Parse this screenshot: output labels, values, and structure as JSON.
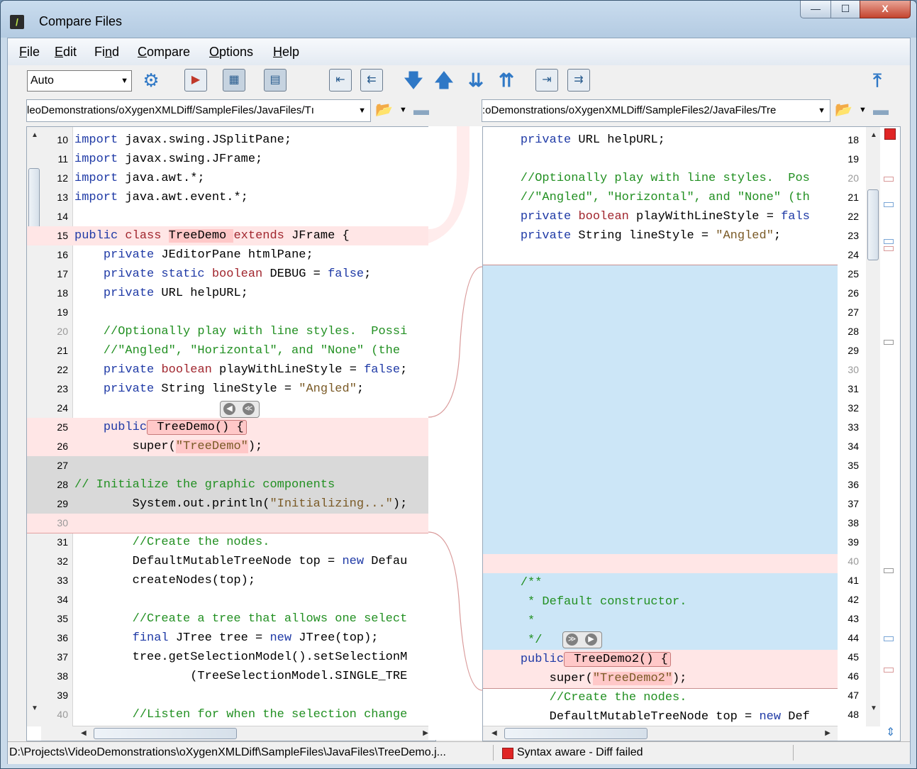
{
  "window": {
    "title": "Compare Files",
    "min_glyph": "—",
    "max_glyph": "☐",
    "close_glyph": "X"
  },
  "menu": [
    {
      "pre": "",
      "u": "F",
      "post": "ile"
    },
    {
      "pre": "",
      "u": "E",
      "post": "dit"
    },
    {
      "pre": "Fi",
      "u": "n",
      "post": "d"
    },
    {
      "pre": "",
      "u": "C",
      "post": "ompare"
    },
    {
      "pre": "",
      "u": "O",
      "post": "ptions"
    },
    {
      "pre": "",
      "u": "H",
      "post": "elp"
    }
  ],
  "toolbar": {
    "mode": "Auto"
  },
  "left": {
    "path": "leoDemonstrations/oXygenXMLDiff/SampleFiles/JavaFiles/Tı",
    "lines": [
      {
        "n": "10",
        "t": "import javax.swing.JSplitPane;"
      },
      {
        "n": "11",
        "t": "import javax.swing.JFrame;"
      },
      {
        "n": "12",
        "t": "import java.awt.*;"
      },
      {
        "n": "13",
        "t": "import java.awt.event.*;"
      },
      {
        "n": "14",
        "t": ""
      },
      {
        "n": "15",
        "t": "public class TreeDemo extends JFrame {"
      },
      {
        "n": "16",
        "t": "    private JEditorPane htmlPane;"
      },
      {
        "n": "17",
        "t": "    private static boolean DEBUG = false;"
      },
      {
        "n": "18",
        "t": "    private URL helpURL;"
      },
      {
        "n": "19",
        "t": ""
      },
      {
        "n": "20",
        "t": "    //Optionally play with line styles.  Possi"
      },
      {
        "n": "21",
        "t": "    //\"Angled\", \"Horizontal\", and \"None\" (the"
      },
      {
        "n": "22",
        "t": "    private boolean playWithLineStyle = false;"
      },
      {
        "n": "23",
        "t": "    private String lineStyle = \"Angled\";"
      },
      {
        "n": "24",
        "t": ""
      },
      {
        "n": "25",
        "t": "    public TreeDemo() {"
      },
      {
        "n": "26",
        "t": "        super(\"TreeDemo\");"
      },
      {
        "n": "27",
        "t": ""
      },
      {
        "n": "28",
        "t": "// Initialize the graphic components"
      },
      {
        "n": "29",
        "t": "        System.out.println(\"Initializing...\");"
      },
      {
        "n": "30",
        "t": ""
      },
      {
        "n": "31",
        "t": "        //Create the nodes."
      },
      {
        "n": "32",
        "t": "        DefaultMutableTreeNode top = new Defau"
      },
      {
        "n": "33",
        "t": "        createNodes(top);"
      },
      {
        "n": "34",
        "t": ""
      },
      {
        "n": "35",
        "t": "        //Create a tree that allows one select"
      },
      {
        "n": "36",
        "t": "        final JTree tree = new JTree(top);"
      },
      {
        "n": "37",
        "t": "        tree.getSelectionModel().setSelectionM"
      },
      {
        "n": "38",
        "t": "                (TreeSelectionModel.SINGLE_TRE"
      },
      {
        "n": "39",
        "t": ""
      },
      {
        "n": "40",
        "t": "        //Listen for when the selection change"
      }
    ]
  },
  "right": {
    "path": ":oDemonstrations/oXygenXMLDiff/SampleFiles2/JavaFiles/Tre",
    "lines": [
      {
        "n": "18",
        "t": "    private URL helpURL;"
      },
      {
        "n": "19",
        "t": ""
      },
      {
        "n": "20",
        "t": "    //Optionally play with line styles.  Pos"
      },
      {
        "n": "21",
        "t": "    //\"Angled\", \"Horizontal\", and \"None\" (th"
      },
      {
        "n": "22",
        "t": "    private boolean playWithLineStyle = fals"
      },
      {
        "n": "23",
        "t": "    private String lineStyle = \"Angled\";"
      },
      {
        "n": "24",
        "t": ""
      },
      {
        "n": "25",
        "t": ""
      },
      {
        "n": "26",
        "t": ""
      },
      {
        "n": "27",
        "t": ""
      },
      {
        "n": "28",
        "t": ""
      },
      {
        "n": "29",
        "t": ""
      },
      {
        "n": "30",
        "t": ""
      },
      {
        "n": "31",
        "t": ""
      },
      {
        "n": "32",
        "t": ""
      },
      {
        "n": "33",
        "t": ""
      },
      {
        "n": "34",
        "t": ""
      },
      {
        "n": "35",
        "t": ""
      },
      {
        "n": "36",
        "t": ""
      },
      {
        "n": "37",
        "t": ""
      },
      {
        "n": "38",
        "t": ""
      },
      {
        "n": "39",
        "t": ""
      },
      {
        "n": "40",
        "t": ""
      },
      {
        "n": "41",
        "t": "    /**"
      },
      {
        "n": "42",
        "t": "     * Default constructor."
      },
      {
        "n": "43",
        "t": "     *"
      },
      {
        "n": "44",
        "t": "     */"
      },
      {
        "n": "45",
        "t": "    public TreeDemo2() {"
      },
      {
        "n": "46",
        "t": "        super(\"TreeDemo2\");"
      },
      {
        "n": "47",
        "t": "        //Create the nodes."
      },
      {
        "n": "48",
        "t": "        DefaultMutableTreeNode top = new Def"
      }
    ]
  },
  "status": {
    "path": "D:\\Projects\\VideoDemonstrations\\oXygenXMLDiff\\SampleFiles\\JavaFiles\\TreeDemo.j...",
    "message": "Syntax aware - Diff failed"
  },
  "colors": {
    "diff_pink": "#ffe6e6",
    "diff_hl": "#ffc8c8",
    "diff_blue": "#cce6f7",
    "diff_grey": "#d9d9d9",
    "error_red": "#e02525"
  }
}
